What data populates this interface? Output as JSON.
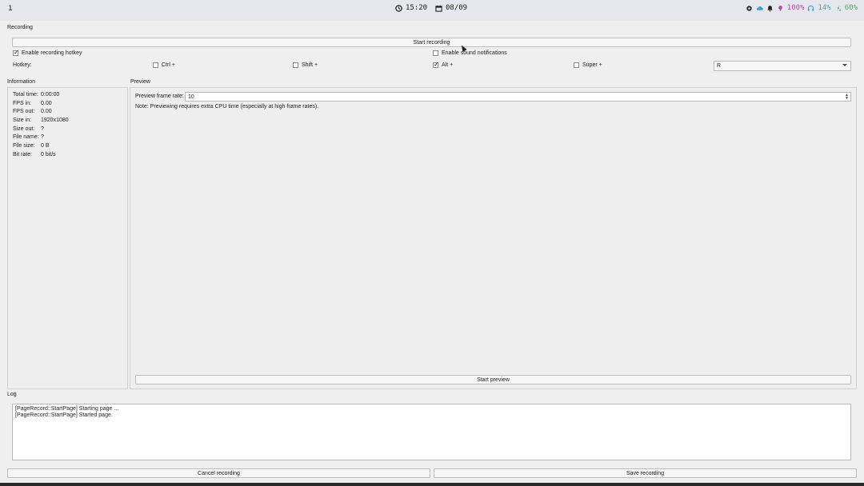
{
  "topbar": {
    "workspace": "1",
    "time": "15:20",
    "date": "08/09",
    "volume": "100%",
    "headphones": "14%",
    "battery": "60%",
    "colors": {
      "volume": "#b44fb1",
      "headphones": "#4a9fc2",
      "battery": "#4caf6a"
    }
  },
  "recording": {
    "title": "Recording",
    "start_label": "Start recording",
    "enable_hotkey_label": "Enable recording hotkey",
    "enable_hotkey_checked": true,
    "enable_sound_label": "Enable sound notifications",
    "enable_sound_checked": false,
    "hotkey_label": "Hotkey:",
    "ctrl_label": "Ctrl +",
    "ctrl_checked": false,
    "shift_label": "Shift +",
    "shift_checked": false,
    "alt_label": "Alt +",
    "alt_checked": true,
    "super_label": "Super +",
    "super_checked": false,
    "key_value": "R"
  },
  "information": {
    "title": "Information",
    "rows": [
      {
        "label": "Total time:",
        "value": "0:00:00"
      },
      {
        "label": "FPS in:",
        "value": "0.00"
      },
      {
        "label": "FPS out:",
        "value": "0.00"
      },
      {
        "label": "Size in:",
        "value": "1920x1080"
      },
      {
        "label": "Size out:",
        "value": "?"
      },
      {
        "label": "File name:",
        "value": "?"
      },
      {
        "label": "File size:",
        "value": "0 B"
      },
      {
        "label": "Bit rate:",
        "value": "0 bit/s"
      }
    ]
  },
  "preview": {
    "title": "Preview",
    "frame_rate_label": "Preview frame rate:",
    "frame_rate_value": "10",
    "note": "Note: Previewing requires extra CPU time (especially at high frame rates).",
    "start_label": "Start preview"
  },
  "log": {
    "title": "Log",
    "lines": [
      "[PageRecord::StartPage] Starting page ...",
      "[PageRecord::StartPage] Started page."
    ]
  },
  "footer": {
    "cancel_label": "Cancel recording",
    "save_label": "Save recording"
  }
}
